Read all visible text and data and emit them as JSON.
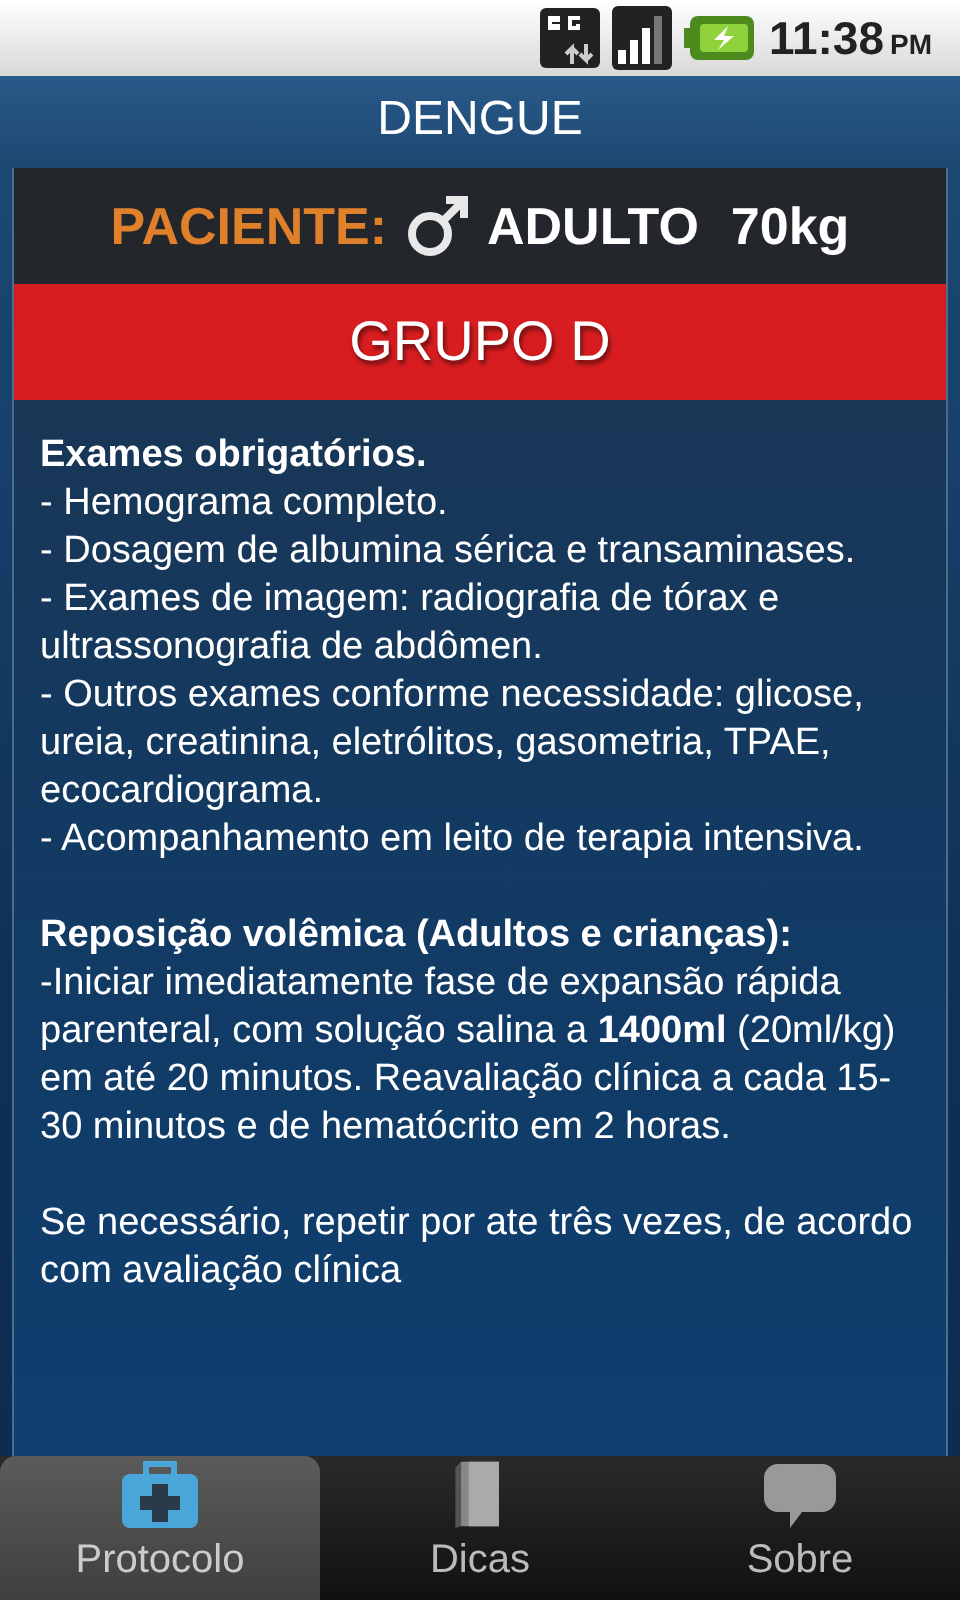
{
  "status_bar": {
    "time": "11:38",
    "ampm": "PM"
  },
  "title": "DENGUE",
  "patient": {
    "label": "PACIENTE:",
    "age_group": "ADULTO",
    "weight": "70kg"
  },
  "group": "GRUPO D",
  "sections": [
    {
      "heading": "Exames obrigatórios.",
      "paragraphs": [
        "- Hemograma completo.",
        "- Dosagem de albumina sérica e transaminases.",
        "- Exames de imagem: radiografia de tórax e ultrassonografia de abdômen.",
        "- Outros exames conforme necessidade: glicose, ureia, creatinina, eletrólitos, gasometria, TPAE, ecocardiograma.",
        "- Acompanhamento em leito de terapia intensiva."
      ]
    },
    {
      "heading": "Reposição volêmica (Adultos e crianças):",
      "paragraphs": [
        "-Iniciar imediatamente fase de expansão rápida parenteral, com solução salina a **1400ml** (20ml/kg) em até 20 minutos. Reavaliação clínica a cada 15-30 minutos e de hematócrito em 2 horas."
      ]
    },
    {
      "paragraphs": [
        "Se necessário, repetir por ate três vezes, de acordo com avaliação clínica"
      ]
    }
  ],
  "tabs": [
    {
      "label": "Protocolo",
      "kind": "kit",
      "selected": true
    },
    {
      "label": "Dicas",
      "kind": "book",
      "selected": false
    },
    {
      "label": "Sobre",
      "kind": "chat",
      "selected": false
    }
  ]
}
